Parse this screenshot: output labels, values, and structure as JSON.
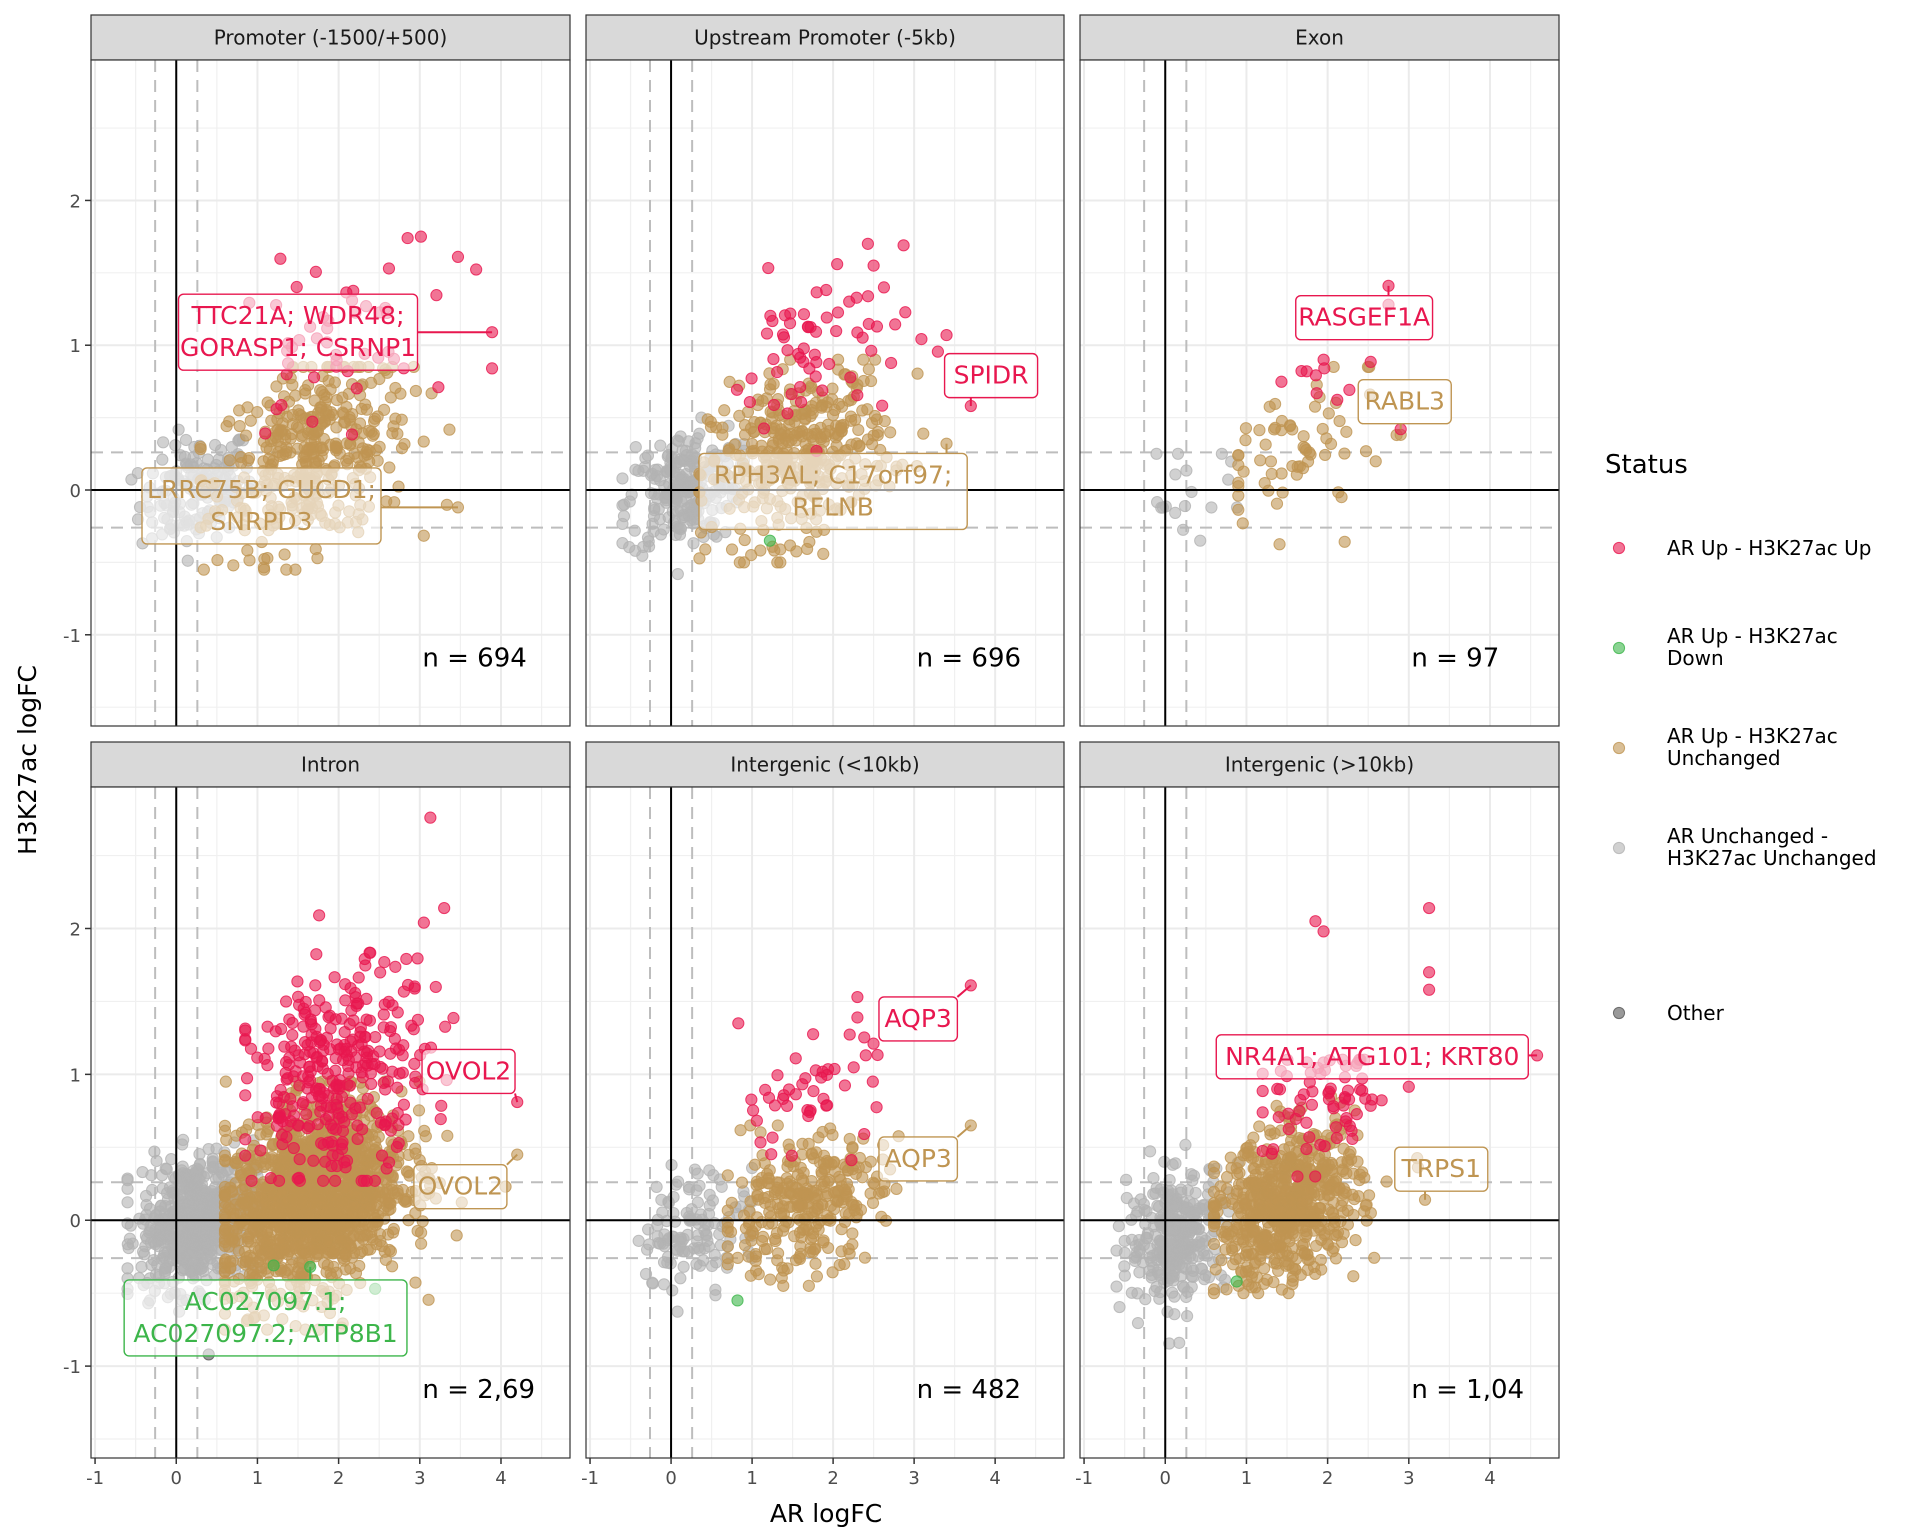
{
  "chart_data": {
    "type": "scatter",
    "title": "",
    "xlabel": "AR logFC",
    "ylabel": "H3K27ac logFC",
    "xlim": [
      -1.05,
      4.85
    ],
    "ylim": [
      -1.63,
      2.97
    ],
    "x_ticks": [
      -1,
      0,
      1,
      2,
      3,
      4
    ],
    "x_tick_labels": [
      "-1",
      "0",
      "1",
      "2",
      "3",
      "4"
    ],
    "y_ticks": [
      -1,
      0,
      1,
      2
    ],
    "y_tick_labels": [
      "-1",
      "0",
      "1",
      "2"
    ],
    "grid": true,
    "reference_lines": {
      "solid": {
        "x": 0,
        "y": 0
      },
      "dashed_x": [
        -0.26,
        0.26
      ],
      "dashed_y": [
        -0.26,
        0.26
      ]
    },
    "legend": {
      "title": "Status",
      "placement": "right",
      "entries": [
        {
          "key": "up_up",
          "label_lines": [
            "AR Up - H3K27ac Up"
          ],
          "color": "#e8174f"
        },
        {
          "key": "up_down",
          "label_lines": [
            "AR Up - H3K27ac",
            "Down"
          ],
          "color": "#3cb54a"
        },
        {
          "key": "up_unch",
          "label_lines": [
            "AR Up - H3K27ac",
            "Unchanged"
          ],
          "color": "#bf9552"
        },
        {
          "key": "unch_unch",
          "label_lines": [
            "AR Unchanged -",
            "H3K27ac Unchanged"
          ],
          "color": "#b3b3b3"
        },
        {
          "key": "other",
          "label_lines": [
            "Other"
          ],
          "color": "#555555"
        }
      ]
    },
    "panels": [
      {
        "title": "Promoter (-1500/+500)",
        "n_label": "n = 694",
        "clusters": [
          {
            "status": "up_unch",
            "count": 380,
            "cx": 1.7,
            "cy": 0.25,
            "sx": 0.6,
            "sy": 0.3,
            "xmin": 0.3,
            "xmax": 3.6,
            "ymin": -0.55,
            "ymax": 0.85
          },
          {
            "status": "unch_unch",
            "count": 150,
            "cx": 0.25,
            "cy": 0.0,
            "sx": 0.35,
            "sy": 0.18,
            "xmin": -0.8,
            "xmax": 0.9,
            "ymin": -0.5,
            "ymax": 0.6
          },
          {
            "status": "up_up",
            "count": 45,
            "cx": 1.8,
            "cy": 1.0,
            "sx": 0.6,
            "sy": 0.3,
            "xmin": 0.9,
            "xmax": 3.9,
            "ymin": 0.27,
            "ymax": 1.75
          }
        ],
        "points": [
          {
            "x": 2.85,
            "y": 1.74,
            "status": "up_up"
          },
          {
            "x": 3.47,
            "y": 1.61,
            "status": "up_up"
          },
          {
            "x": 2.62,
            "y": 1.53,
            "status": "up_up"
          },
          {
            "x": 3.89,
            "y": 1.09,
            "status": "up_up"
          },
          {
            "x": 3.89,
            "y": 0.84,
            "status": "up_up"
          },
          {
            "x": 3.47,
            "y": -0.12,
            "status": "up_unch"
          }
        ],
        "labels": [
          {
            "lines": [
              "TTC21A; WDR48;",
              "GORASP1; CSRNP1"
            ],
            "status": "up_up",
            "x": 1.5,
            "y": 1.09,
            "px": 3.89,
            "py": 1.09
          },
          {
            "lines": [
              "LRRC75B; GUCD1;",
              "SNRPD3"
            ],
            "status": "up_unch",
            "x": 1.05,
            "y": -0.11,
            "px": 3.47,
            "py": -0.12
          }
        ]
      },
      {
        "title": "Upstream Promoter (-5kb)",
        "n_label": "n = 696",
        "clusters": [
          {
            "status": "up_unch",
            "count": 380,
            "cx": 1.6,
            "cy": 0.25,
            "sx": 0.55,
            "sy": 0.28,
            "xmin": 0.35,
            "xmax": 3.6,
            "ymin": -0.5,
            "ymax": 0.9
          },
          {
            "status": "unch_unch",
            "count": 230,
            "cx": 0.15,
            "cy": 0.0,
            "sx": 0.35,
            "sy": 0.2,
            "xmin": -0.6,
            "xmax": 0.9,
            "ymin": -0.7,
            "ymax": 0.5
          },
          {
            "status": "up_up",
            "count": 60,
            "cx": 1.8,
            "cy": 0.95,
            "sx": 0.55,
            "sy": 0.3,
            "xmin": 0.7,
            "xmax": 3.6,
            "ymin": 0.27,
            "ymax": 1.7
          }
        ],
        "points": [
          {
            "x": 2.87,
            "y": 1.69,
            "status": "up_up"
          },
          {
            "x": 2.05,
            "y": 1.56,
            "status": "up_up"
          },
          {
            "x": 2.5,
            "y": 1.55,
            "status": "up_up"
          },
          {
            "x": 3.4,
            "y": 1.07,
            "status": "up_up"
          },
          {
            "x": 3.7,
            "y": 0.58,
            "status": "up_up"
          },
          {
            "x": 3.4,
            "y": 0.32,
            "status": "up_unch"
          },
          {
            "x": 1.22,
            "y": -0.35,
            "status": "up_down"
          }
        ],
        "labels": [
          {
            "lines": [
              "SPIDR"
            ],
            "status": "up_up",
            "x": 3.95,
            "y": 0.79,
            "px": 3.7,
            "py": 0.58
          },
          {
            "lines": [
              "RPH3AL; C17orf97;",
              "RFLNB"
            ],
            "status": "up_unch",
            "x": 2.0,
            "y": -0.01,
            "px": 3.4,
            "py": 0.32
          }
        ]
      },
      {
        "title": "Exon",
        "n_label": "n = 97",
        "clusters": [
          {
            "status": "up_unch",
            "count": 65,
            "cx": 1.6,
            "cy": 0.25,
            "sx": 0.55,
            "sy": 0.28,
            "xmin": 0.9,
            "xmax": 2.9,
            "ymin": -0.4,
            "ymax": 0.85
          },
          {
            "status": "unch_unch",
            "count": 18,
            "cx": 0.3,
            "cy": -0.05,
            "sx": 0.35,
            "sy": 0.15,
            "xmin": -0.4,
            "xmax": 0.9,
            "ymin": -0.35,
            "ymax": 0.25
          },
          {
            "status": "up_up",
            "count": 10,
            "cx": 1.8,
            "cy": 0.7,
            "sx": 0.5,
            "sy": 0.15,
            "xmin": 1.1,
            "xmax": 2.8,
            "ymin": 0.4,
            "ymax": 0.9
          }
        ],
        "points": [
          {
            "x": 2.75,
            "y": 1.41,
            "status": "up_up"
          },
          {
            "x": 2.75,
            "y": 1.28,
            "status": "up_up"
          },
          {
            "x": 2.9,
            "y": 0.42,
            "status": "up_up"
          },
          {
            "x": 2.85,
            "y": 0.38,
            "status": "up_unch"
          }
        ],
        "labels": [
          {
            "lines": [
              "RASGEF1A"
            ],
            "status": "up_up",
            "x": 2.45,
            "y": 1.19,
            "px": 2.75,
            "py": 1.41
          },
          {
            "lines": [
              "RABL3"
            ],
            "status": "up_unch",
            "x": 2.95,
            "y": 0.61,
            "px": 2.9,
            "py": 0.42
          }
        ]
      },
      {
        "title": "Intron",
        "n_label": "n = 2,69",
        "clusters": [
          {
            "status": "up_unch",
            "count": 1500,
            "cx": 1.7,
            "cy": 0.15,
            "sx": 0.55,
            "sy": 0.3,
            "xmin": 0.6,
            "xmax": 4.2,
            "ymin": -0.75,
            "ymax": 0.95
          },
          {
            "status": "unch_unch",
            "count": 600,
            "cx": 0.25,
            "cy": 0.0,
            "sx": 0.35,
            "sy": 0.22,
            "xmin": -0.6,
            "xmax": 1.0,
            "ymin": -0.9,
            "ymax": 0.85
          },
          {
            "status": "up_up",
            "count": 320,
            "cx": 2.0,
            "cy": 1.0,
            "sx": 0.55,
            "sy": 0.35,
            "xmin": 0.85,
            "xmax": 3.8,
            "ymin": 0.27,
            "ymax": 2.1
          }
        ],
        "points": [
          {
            "x": 3.13,
            "y": 2.76,
            "status": "up_up"
          },
          {
            "x": 3.3,
            "y": 2.14,
            "status": "up_up"
          },
          {
            "x": 1.76,
            "y": 2.09,
            "status": "up_up"
          },
          {
            "x": 3.05,
            "y": 2.04,
            "status": "up_up"
          },
          {
            "x": 4.2,
            "y": 0.81,
            "status": "up_up"
          },
          {
            "x": 4.2,
            "y": 0.45,
            "status": "up_unch"
          },
          {
            "x": 1.2,
            "y": -0.31,
            "status": "up_down"
          },
          {
            "x": 1.65,
            "y": -0.32,
            "status": "up_down"
          },
          {
            "x": 2.45,
            "y": -0.47,
            "status": "up_down"
          },
          {
            "x": 0.4,
            "y": -0.92,
            "status": "other"
          }
        ],
        "labels": [
          {
            "lines": [
              "OVOL2"
            ],
            "status": "up_up",
            "x": 3.6,
            "y": 1.02,
            "px": 4.2,
            "py": 0.81
          },
          {
            "lines": [
              "OVOL2"
            ],
            "status": "up_unch",
            "x": 3.5,
            "y": 0.23,
            "px": 4.2,
            "py": 0.45
          },
          {
            "lines": [
              "AC027097.1;",
              "AC027097.2; ATP8B1"
            ],
            "status": "up_down",
            "x": 1.1,
            "y": -0.67,
            "px": 1.65,
            "py": -0.32
          }
        ]
      },
      {
        "title": "Intergenic (<10kb)",
        "n_label": "n = 482",
        "clusters": [
          {
            "status": "up_unch",
            "count": 300,
            "cx": 1.6,
            "cy": 0.1,
            "sx": 0.5,
            "sy": 0.22,
            "xmin": 0.7,
            "xmax": 3.3,
            "ymin": -0.45,
            "ymax": 0.65
          },
          {
            "status": "unch_unch",
            "count": 120,
            "cx": 0.3,
            "cy": -0.05,
            "sx": 0.35,
            "sy": 0.2,
            "xmin": -0.4,
            "xmax": 1.0,
            "ymin": -0.8,
            "ymax": 0.5
          },
          {
            "status": "up_up",
            "count": 45,
            "cx": 1.7,
            "cy": 0.85,
            "sx": 0.5,
            "sy": 0.2,
            "xmin": 0.8,
            "xmax": 3.0,
            "ymin": 0.3,
            "ymax": 1.35
          }
        ],
        "points": [
          {
            "x": 3.7,
            "y": 1.61,
            "status": "up_up"
          },
          {
            "x": 2.3,
            "y": 1.53,
            "status": "up_up"
          },
          {
            "x": 0.83,
            "y": 1.35,
            "status": "up_up"
          },
          {
            "x": 2.3,
            "y": 1.39,
            "status": "up_up"
          },
          {
            "x": 3.7,
            "y": 0.65,
            "status": "up_unch"
          },
          {
            "x": 0.82,
            "y": -0.55,
            "status": "up_down"
          }
        ],
        "labels": [
          {
            "lines": [
              "AQP3"
            ],
            "status": "up_up",
            "x": 3.05,
            "y": 1.38,
            "px": 3.7,
            "py": 1.61
          },
          {
            "lines": [
              "AQP3"
            ],
            "status": "up_unch",
            "x": 3.05,
            "y": 0.42,
            "px": 3.7,
            "py": 0.65
          }
        ]
      },
      {
        "title": "Intergenic (>10kb)",
        "n_label": "n = 1,04",
        "clusters": [
          {
            "status": "up_unch",
            "count": 650,
            "cx": 1.5,
            "cy": 0.1,
            "sx": 0.45,
            "sy": 0.25,
            "xmin": 0.6,
            "xmax": 3.3,
            "ymin": -0.5,
            "ymax": 0.85
          },
          {
            "status": "unch_unch",
            "count": 300,
            "cx": 0.15,
            "cy": -0.1,
            "sx": 0.3,
            "sy": 0.22,
            "xmin": -0.6,
            "xmax": 0.95,
            "ymin": -0.9,
            "ymax": 0.7
          },
          {
            "status": "up_up",
            "count": 70,
            "cx": 2.0,
            "cy": 0.8,
            "sx": 0.45,
            "sy": 0.2,
            "xmin": 1.2,
            "xmax": 3.0,
            "ymin": 0.3,
            "ymax": 1.1
          }
        ],
        "points": [
          {
            "x": 3.25,
            "y": 2.14,
            "status": "up_up"
          },
          {
            "x": 1.85,
            "y": 2.05,
            "status": "up_up"
          },
          {
            "x": 1.95,
            "y": 1.98,
            "status": "up_up"
          },
          {
            "x": 3.25,
            "y": 1.7,
            "status": "up_up"
          },
          {
            "x": 3.25,
            "y": 1.58,
            "status": "up_up"
          },
          {
            "x": 4.58,
            "y": 1.13,
            "status": "up_up"
          },
          {
            "x": 3.2,
            "y": 0.14,
            "status": "up_unch"
          },
          {
            "x": 0.88,
            "y": -0.42,
            "status": "up_down"
          }
        ],
        "labels": [
          {
            "lines": [
              "NR4A1; ATG101; KRT80"
            ],
            "status": "up_up",
            "x": 2.55,
            "y": 1.12,
            "px": 4.58,
            "py": 1.13
          },
          {
            "lines": [
              "TRPS1"
            ],
            "status": "up_unch",
            "x": 3.4,
            "y": 0.35,
            "px": 3.2,
            "py": 0.14
          }
        ]
      }
    ]
  }
}
